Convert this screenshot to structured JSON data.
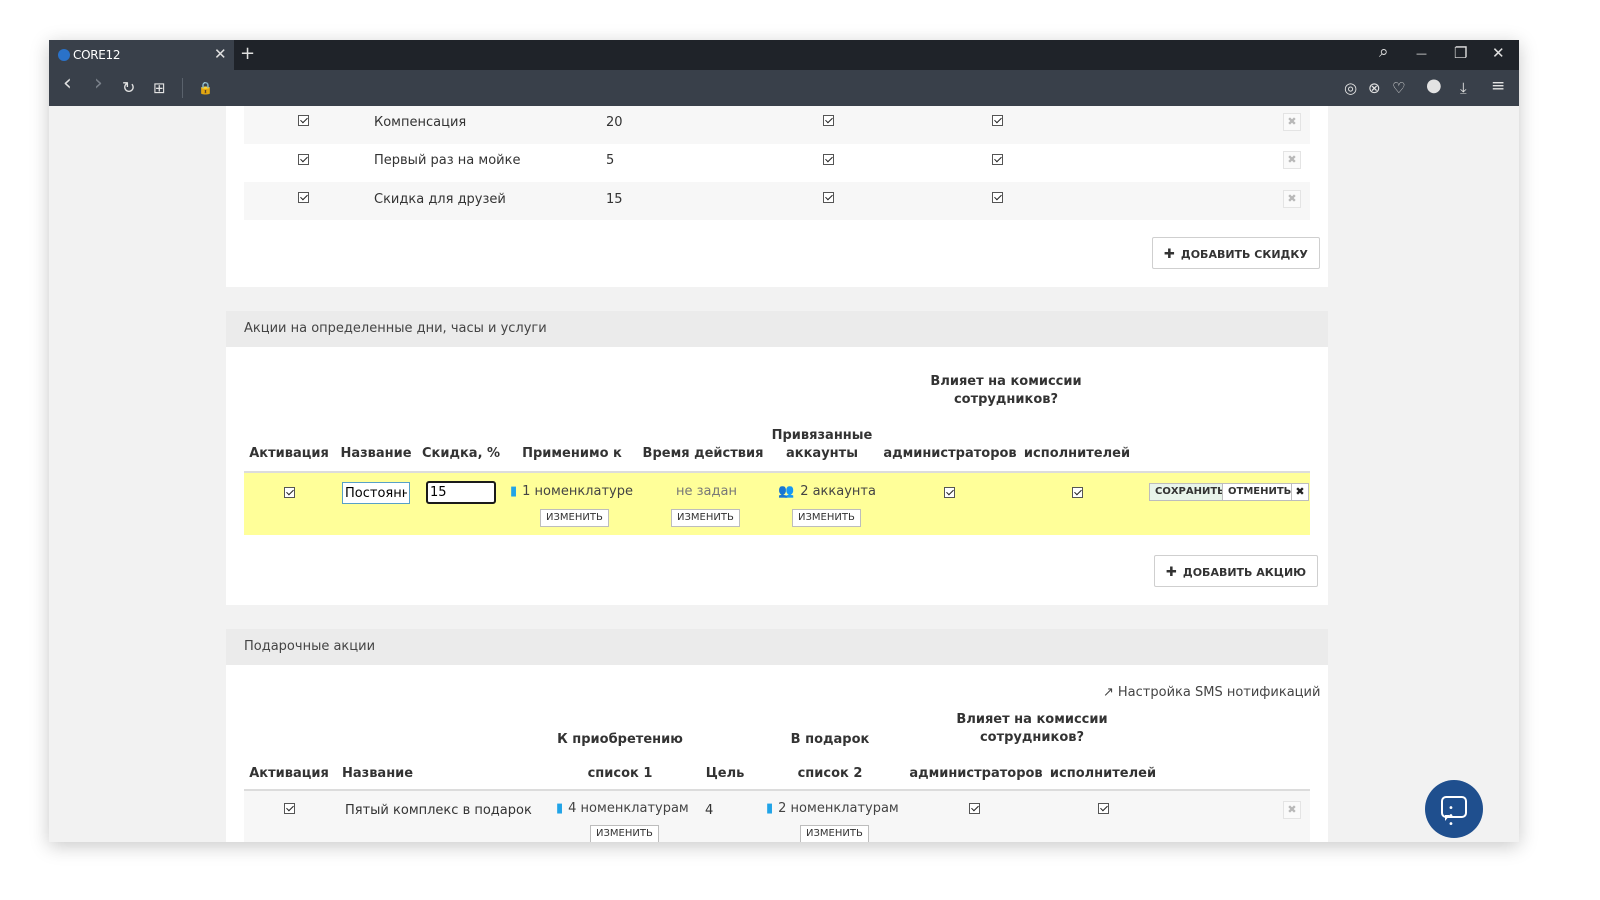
{
  "browser": {
    "tab_title": "CORE12",
    "tab_close": "✕",
    "new_tab": "+",
    "search_icon": "⌕",
    "minimize": "—",
    "restore": "❐",
    "close": "✕",
    "back": "‹",
    "forward": "›",
    "reload": "↻",
    "grid": "⊞",
    "lock": "🔒",
    "camera": "◎",
    "shield": "⊗",
    "heart": "♡",
    "avatar": "●",
    "download": "⤓",
    "menu": "≡"
  },
  "discounts": {
    "rows": [
      {
        "name": "Компенсация",
        "value": "20"
      },
      {
        "name": "Первый раз на мойке",
        "value": "5"
      },
      {
        "name": "Скидка для друзей",
        "value": "15"
      }
    ],
    "add_label": "ДОБАВИТЬ СКИДКУ"
  },
  "promos": {
    "header": "Акции на определенные дни, часы и услуги",
    "group_header": "Влияет на комиссии сотрудников?",
    "columns": {
      "activation": "Активация",
      "name": "Название",
      "discount": "Скидка, %",
      "applies_to": "Применимо к",
      "time": "Время действия",
      "accounts": "Привязанные аккаунты",
      "admins": "администраторов",
      "performers": "исполнителей"
    },
    "row": {
      "name_value": "Постоянн",
      "discount_value": "15",
      "applies_to": "1 номенклатуре",
      "time": "не задан",
      "accounts": "2 аккаунта",
      "change": "ИЗМЕНИТЬ",
      "save": "СОХРАНИТЬ",
      "cancel": "ОТМЕНИТЬ",
      "delete": "✖"
    },
    "add_label": "ДОБАВИТЬ АКЦИЮ"
  },
  "gifts": {
    "header": "Подарочные акции",
    "sms_link": "Настройка SMS нотификаций",
    "group_header": "Влияет на комиссии сотрудников?",
    "columns": {
      "activation": "Активация",
      "name": "Название",
      "purchase": "К приобретению",
      "list1": "список 1",
      "goal": "Цель",
      "gift": "В подарок",
      "list2": "список 2",
      "admins": "администраторов",
      "performers": "исполнителей"
    },
    "row": {
      "name": "Пятый комплекс в подарок",
      "list1": "4 номенклатурам",
      "goal": "4",
      "list2": "2 номенклатурам",
      "change": "ИЗМЕНИТЬ"
    }
  },
  "x_mark": "✖"
}
